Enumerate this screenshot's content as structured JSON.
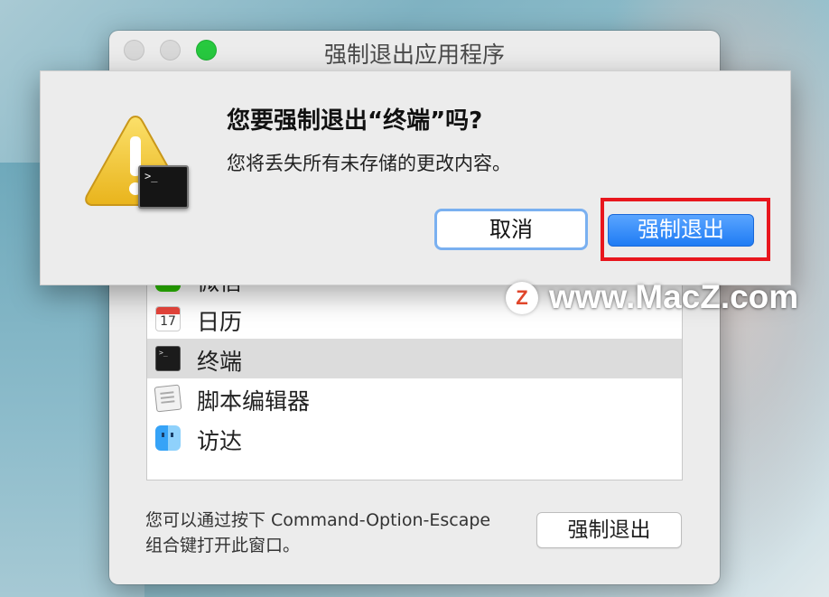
{
  "window": {
    "title": "强制退出应用程序"
  },
  "apps": [
    {
      "label": "微信",
      "icon": "wechat-icon"
    },
    {
      "label": "日历",
      "icon": "calendar-icon",
      "icon_text": "17"
    },
    {
      "label": "终端",
      "icon": "terminal-icon",
      "selected": true
    },
    {
      "label": "脚本编辑器",
      "icon": "script-editor-icon"
    },
    {
      "label": "访达",
      "icon": "finder-icon"
    }
  ],
  "hint": {
    "line1": "您可以通过按下 Command-Option-Escape",
    "line2": "组合键打开此窗口。"
  },
  "force_quit_label": "强制退出",
  "alert": {
    "title": "您要强制退出“终端”吗?",
    "message": "您将丢失所有未存储的更改内容。",
    "cancel_label": "取消",
    "confirm_label": "强制退出",
    "terminal_prompt": ">_"
  },
  "watermark": {
    "logo": "Z",
    "text": "www.MacZ.com"
  },
  "colors": {
    "primary_button": "#1f7cf4",
    "highlight_box": "#e8161d",
    "zoom_button": "#27c93f"
  }
}
